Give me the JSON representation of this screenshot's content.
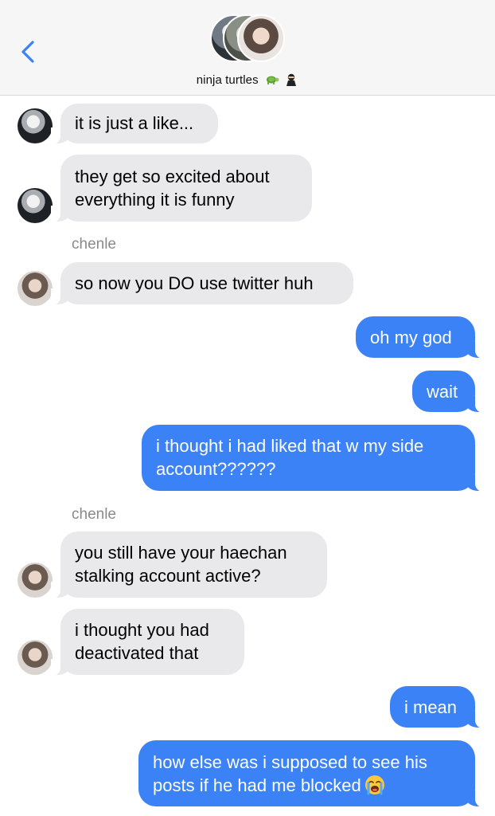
{
  "header": {
    "group_name": "ninja turtles",
    "emojis": [
      "turtle-emoji",
      "ninja-emoji"
    ]
  },
  "messages": [
    {
      "direction": "in",
      "avatar": "white-hair-avatar",
      "text": "it is just a like..."
    },
    {
      "direction": "in",
      "avatar": "white-hair-avatar",
      "lines": [
        "they get so excited about",
        "everything it is funny"
      ]
    },
    {
      "sender": "chenle"
    },
    {
      "direction": "in",
      "avatar": "chenle-avatar",
      "text": "so now you DO use twitter huh"
    },
    {
      "direction": "out",
      "text": "oh my god"
    },
    {
      "direction": "out",
      "text": "wait"
    },
    {
      "direction": "out",
      "lines": [
        "i thought i had liked that w my side",
        "account??????"
      ]
    },
    {
      "sender": "chenle"
    },
    {
      "direction": "in",
      "avatar": "chenle-avatar",
      "lines": [
        "you still have your haechan",
        "stalking account active?"
      ]
    },
    {
      "direction": "in",
      "avatar": "chenle-avatar",
      "lines": [
        "i thought you had",
        "deactivated that"
      ]
    },
    {
      "direction": "out",
      "text": "i mean"
    },
    {
      "direction": "out",
      "lines": [
        "how else was i supposed to see his",
        "posts if he had me blocked"
      ],
      "emoji": "loudly-crying-face"
    }
  ],
  "colors": {
    "incoming_bubble": "#e9e9eb",
    "outgoing_bubble": "#3b82f6",
    "accent": "#3b82f6",
    "header_bg": "#f6f6f6"
  }
}
